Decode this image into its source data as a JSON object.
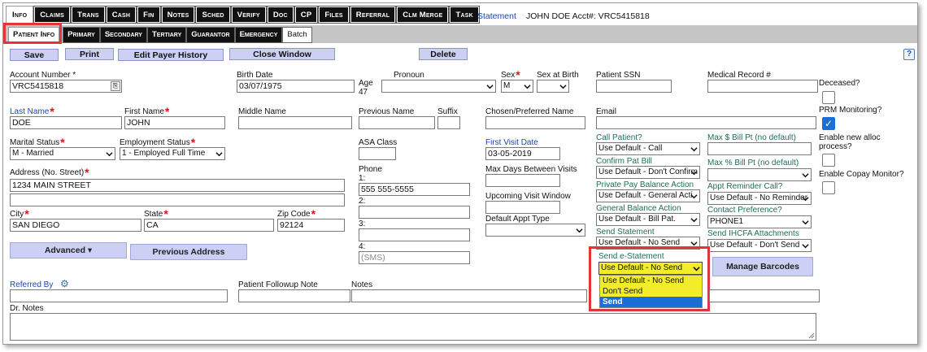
{
  "tabs": [
    "Info",
    "Claims",
    "Trans",
    "Cash",
    "Fin",
    "Notes",
    "Sched",
    "Verify",
    "Doc",
    "CP",
    "Files",
    "Referral",
    "Clm Merge",
    "Task"
  ],
  "header": {
    "statement_link": "Statement",
    "account_info": "JOHN DOE Acct#: VRC5415818"
  },
  "subtabs": [
    "Patient Info",
    "Primary",
    "Secondary",
    "Tertiary",
    "Guarantor",
    "Emergency",
    "Batch"
  ],
  "actions": {
    "save": "Save",
    "print": "Print",
    "edit_payer_history": "Edit Payer History",
    "close_window": "Close Window",
    "delete": "Delete",
    "help": "?"
  },
  "form": {
    "account_number": {
      "label": "Account Number *",
      "value": "VRC5415818"
    },
    "birth_date": {
      "label": "Birth Date",
      "value": "03/07/1975"
    },
    "age": {
      "label": "Age",
      "value": "47"
    },
    "pronoun": {
      "label": "Pronoun",
      "value": ""
    },
    "sex": {
      "label": "Sex",
      "value": "M"
    },
    "sex_at_birth": {
      "label": "Sex at Birth",
      "value": ""
    },
    "patient_ssn": {
      "label": "Patient SSN",
      "value": ""
    },
    "medical_record": {
      "label": "Medical Record #",
      "value": ""
    },
    "deceased": {
      "label": "Deceased?",
      "checked": false
    },
    "last_name": {
      "label": "Last Name",
      "value": "DOE"
    },
    "first_name": {
      "label": "First Name",
      "value": "JOHN"
    },
    "middle_name": {
      "label": "Middle Name",
      "value": ""
    },
    "previous_name": {
      "label": "Previous Name",
      "value": ""
    },
    "suffix": {
      "label": "Suffix",
      "value": ""
    },
    "chosen_name": {
      "label": "Chosen/Preferred Name",
      "value": ""
    },
    "email": {
      "label": "Email",
      "value": ""
    },
    "prm_monitoring": {
      "label": "PRM Monitoring?",
      "checked": true
    },
    "marital_status": {
      "label": "Marital Status",
      "value": "M - Married"
    },
    "employment_status": {
      "label": "Employment Status",
      "value": "1 - Employed Full Time"
    },
    "asa_class": {
      "label": "ASA Class",
      "value": ""
    },
    "first_visit_date": {
      "label": "First Visit Date",
      "value": "03-05-2019"
    },
    "call_patient": {
      "label": "Call Patient?",
      "value": "Use Default - Call"
    },
    "max_bill_pt": {
      "label": "Max $ Bill Pt (no default)",
      "value": ""
    },
    "enable_new_alloc": {
      "label": "Enable new alloc process?",
      "checked": false
    },
    "address": {
      "label": "Address (No. Street)",
      "line1": "1234 MAIN STREET",
      "line2": ""
    },
    "phone": {
      "label": "Phone",
      "p1_label": "1:",
      "p1": "555 555-5555",
      "p2_label": "2:",
      "p2": "",
      "p3_label": "3:",
      "p3": "",
      "p4_label": "4:",
      "p4": "(SMS)"
    },
    "max_days_between": {
      "label": "Max Days Between Visits",
      "value": ""
    },
    "confirm_pat_bill": {
      "label": "Confirm Pat Bill",
      "value": "Use Default - Don't Confirm"
    },
    "max_pct_bill": {
      "label": "Max % Bill Pt (no default)",
      "value": ""
    },
    "enable_copay": {
      "label": "Enable Copay Monitor?",
      "checked": false
    },
    "private_pay": {
      "label": "Private Pay Balance Action",
      "value": "Use Default - General Acti"
    },
    "appt_reminder": {
      "label": "Appt Reminder Call?",
      "value": "Use Default - No Reminder"
    },
    "upcoming_visit": {
      "label": "Upcoming Visit Window",
      "value": ""
    },
    "city": {
      "label": "City",
      "value": "SAN DIEGO"
    },
    "state": {
      "label": "State",
      "value": "CA"
    },
    "zip": {
      "label": "Zip Code",
      "value": "92124"
    },
    "default_appt_type": {
      "label": "Default Appt Type",
      "value": ""
    },
    "general_balance": {
      "label": "General Balance Action",
      "value": "Use Default - Bill Pat."
    },
    "contact_preference": {
      "label": "Contact Preference?",
      "value": "PHONE1"
    },
    "send_statement": {
      "label": "Send Statement",
      "value": "Use Default - No Send"
    },
    "send_ihcfa": {
      "label": "Send IHCFA Attachments",
      "value": "Use Default - Don't Send"
    },
    "send_estatement": {
      "label": "Send e-Statement",
      "value": "Use Default - No Send",
      "options": [
        "Use Default - No Send",
        "Don't Send",
        "Send"
      ]
    },
    "referred_by": {
      "label": "Referred By",
      "value": ""
    },
    "followup_note": {
      "label": "Patient Followup Note",
      "value": ""
    },
    "notes": {
      "label": "Notes",
      "value": ""
    },
    "dr_notes": {
      "label": "Dr. Notes",
      "value": ""
    }
  },
  "buttons": {
    "advanced": "Advanced ▾",
    "previous_address": "Previous Address",
    "manage_barcodes": "Manage Barcodes"
  },
  "colors": {
    "highlight_box": "#e2353b",
    "button_bg": "#cdd0f5",
    "dropdown_bg": "#f3ec2a",
    "selected_option": "#1a6fd6"
  }
}
